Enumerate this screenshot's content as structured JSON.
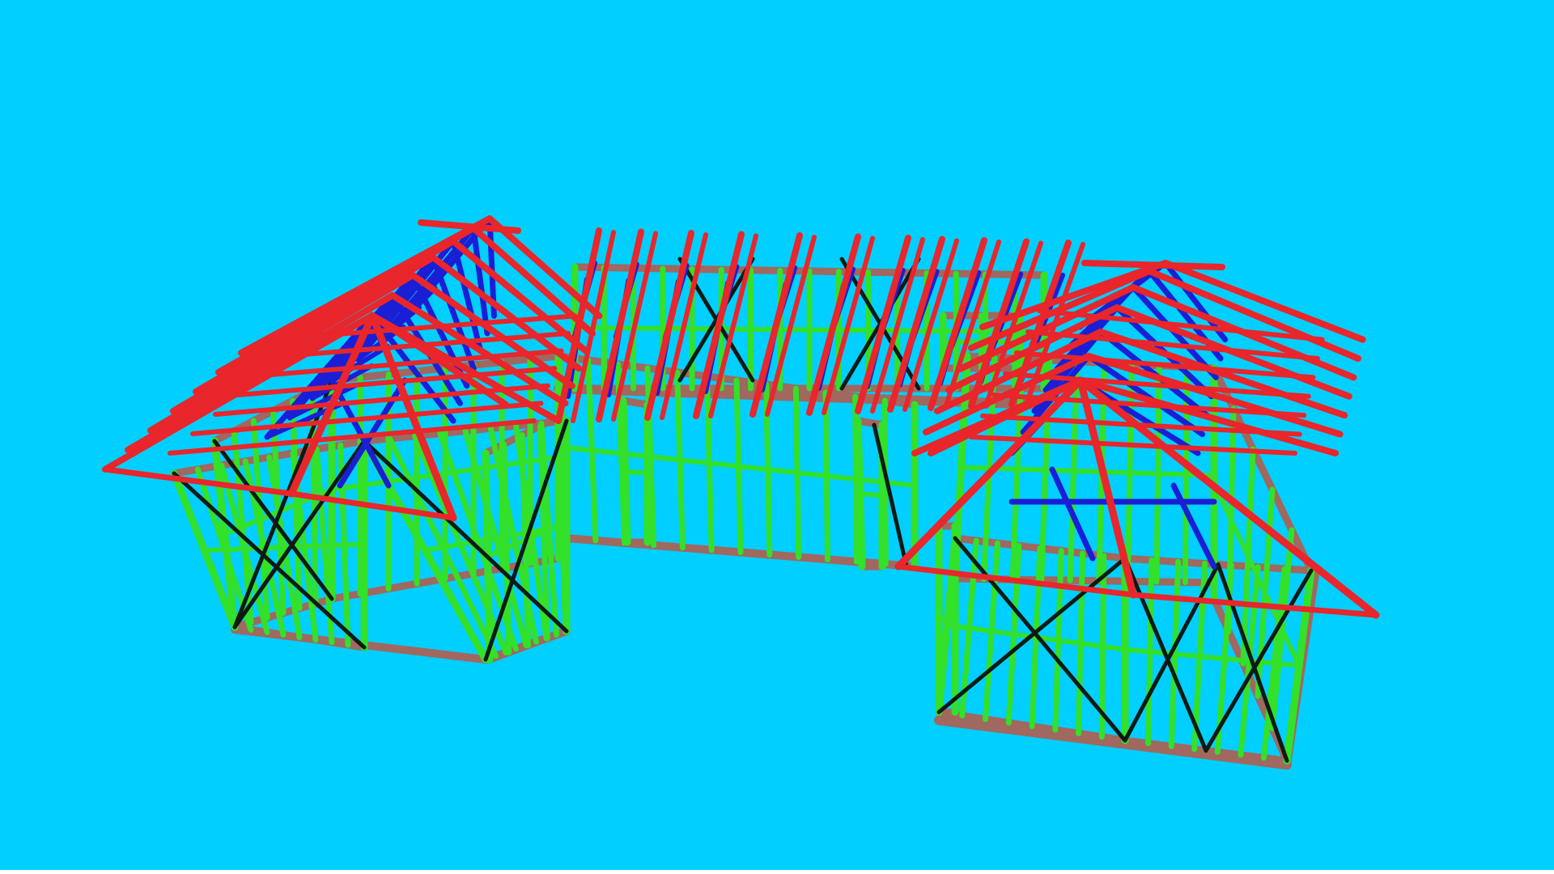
{
  "scene": {
    "background_color": "#00cfff",
    "bottom_strip_color": "#ffffff",
    "members": {
      "rafter": {
        "name": "rafters",
        "color": "#e8262b"
      },
      "web": {
        "name": "truss-webs",
        "color": "#1a1fd6"
      },
      "stud": {
        "name": "wall-studs",
        "color": "#33e02a"
      },
      "brace": {
        "name": "cross-braces",
        "color": "#0d1a12"
      },
      "plate": {
        "name": "plates",
        "color": "#a0685f"
      }
    }
  }
}
